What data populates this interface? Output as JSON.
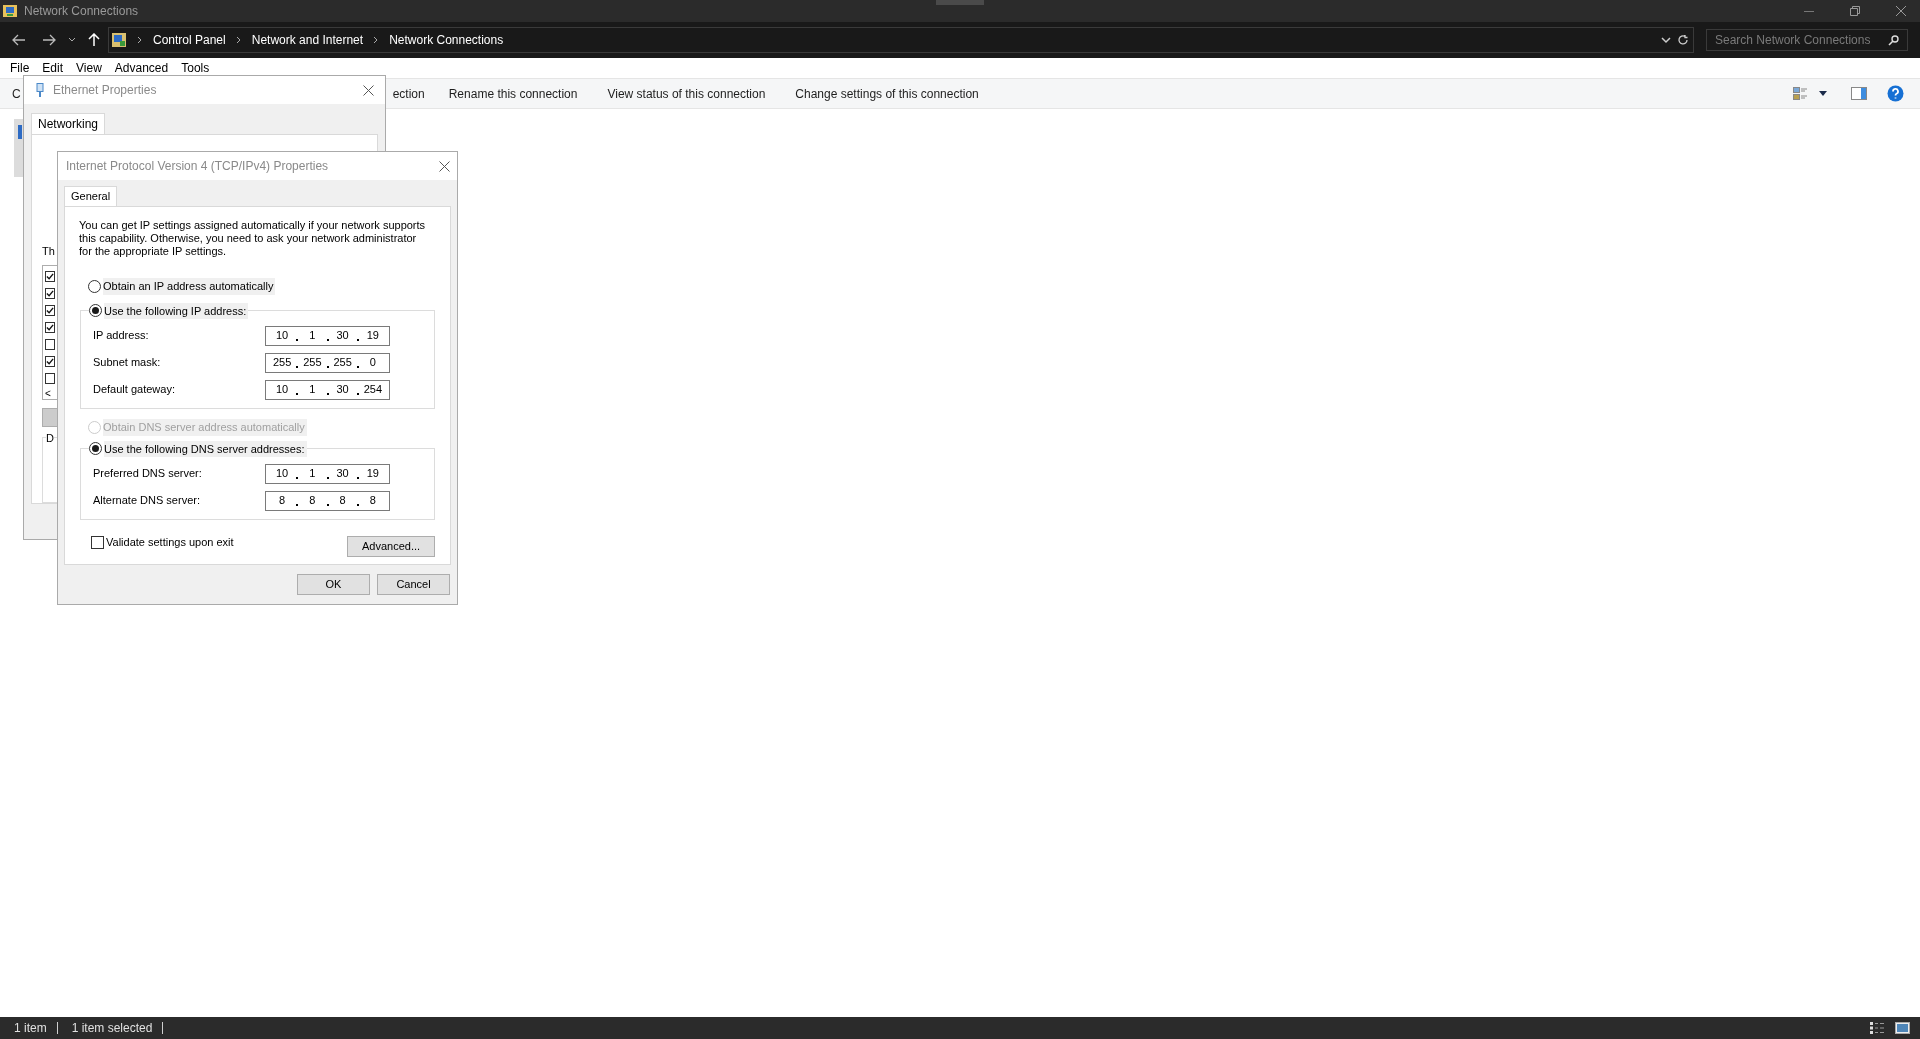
{
  "window": {
    "title": "Network Connections"
  },
  "address_bar": {
    "breadcrumbs": [
      "Control Panel",
      "Network and Internet",
      "Network Connections"
    ]
  },
  "search": {
    "placeholder": "Search Network Connections"
  },
  "menu": [
    "File",
    "Edit",
    "View",
    "Advanced",
    "Tools"
  ],
  "toolbar": {
    "items": [
      "C",
      "ection",
      "Rename this connection",
      "View status of this connection",
      "Change settings of this connection"
    ]
  },
  "ethernet_dialog": {
    "title": "Ethernet Properties",
    "tabs": [
      {
        "label": "Networking",
        "selected": true
      }
    ],
    "partial_labels": [
      "Th",
      "D"
    ],
    "components": [
      {
        "checked": true
      },
      {
        "checked": true
      },
      {
        "checked": true
      },
      {
        "checked": true
      },
      {
        "checked": false
      },
      {
        "checked": true
      },
      {
        "checked": false
      }
    ],
    "scroll_arrow": "<"
  },
  "ipv4_dialog": {
    "title": "Internet Protocol Version 4 (TCP/IPv4) Properties",
    "tabs": [
      {
        "label": "General",
        "selected": true
      }
    ],
    "description": "You can get IP settings assigned automatically if your network supports this capability. Otherwise, you need to ask your network administrator for the appropriate IP settings.",
    "ip_options": [
      {
        "label": "Obtain an IP address automatically",
        "selected": false,
        "disabled": false
      },
      {
        "label": "Use the following IP address:",
        "selected": true,
        "disabled": false
      }
    ],
    "ip_fields": [
      {
        "label": "IP address:",
        "octets": [
          "10",
          "1",
          "30",
          "19"
        ]
      },
      {
        "label": "Subnet mask:",
        "octets": [
          "255",
          "255",
          "255",
          "0"
        ]
      },
      {
        "label": "Default gateway:",
        "octets": [
          "10",
          "1",
          "30",
          "254"
        ]
      }
    ],
    "dns_options": [
      {
        "label": "Obtain DNS server address automatically",
        "selected": false,
        "disabled": true
      },
      {
        "label": "Use the following DNS server addresses:",
        "selected": true,
        "disabled": false
      }
    ],
    "dns_fields": [
      {
        "label": "Preferred DNS server:",
        "octets": [
          "10",
          "1",
          "30",
          "19"
        ]
      },
      {
        "label": "Alternate DNS server:",
        "octets": [
          "8",
          "8",
          "8",
          "8"
        ]
      }
    ],
    "validate": {
      "label": "Validate settings upon exit",
      "checked": false
    },
    "advanced_button": "Advanced...",
    "buttons": [
      "OK",
      "Cancel"
    ]
  },
  "status_bar": [
    "1 item",
    "1 item selected"
  ]
}
